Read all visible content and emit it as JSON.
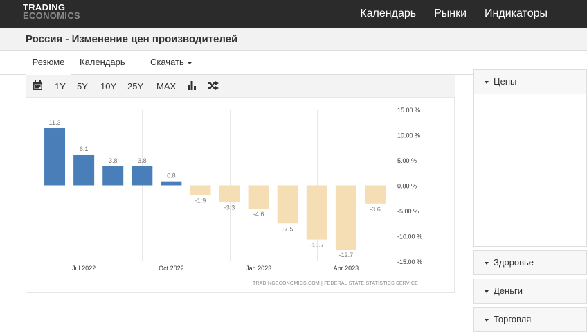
{
  "brand": {
    "line1": "TRADING",
    "line2": "ECONOMICS"
  },
  "nav": [
    {
      "label": "Календарь"
    },
    {
      "label": "Рынки"
    },
    {
      "label": "Индикаторы"
    }
  ],
  "page_title": "Россия - Изменение цен производителей",
  "tabs": [
    {
      "label": "Резюме"
    },
    {
      "label": "Календарь"
    },
    {
      "label": "Скачать"
    }
  ],
  "toolbar": {
    "ranges": [
      "1Y",
      "5Y",
      "10Y",
      "25Y",
      "MAX"
    ],
    "icons": [
      "calendar-icon",
      "bar-chart-icon",
      "shuffle-icon"
    ]
  },
  "sidebar": [
    {
      "label": "Цены"
    },
    {
      "label": "Здоровье"
    },
    {
      "label": "Деньги"
    },
    {
      "label": "Торговля"
    }
  ],
  "colors": {
    "positive": "#4a7eb8",
    "negative": "#f5deb3",
    "topbar": "#2b2b2b"
  },
  "chart_data": {
    "type": "bar",
    "values": [
      11.3,
      6.1,
      3.8,
      3.8,
      0.8,
      -1.9,
      -3.3,
      -4.6,
      -7.5,
      -10.7,
      -12.7,
      -3.6
    ],
    "value_labels": [
      "11.3",
      "6.1",
      "3.8",
      "3.8",
      "0.8",
      "-1.9",
      "-3.3",
      "-4.6",
      "-7.5",
      "-10.7",
      "-12.7",
      "-3.6"
    ],
    "x_tick_labels": [
      "Jul 2022",
      "Oct 2022",
      "Jan 2023",
      "Apr 2023"
    ],
    "y_ticks": [
      15,
      10,
      5,
      0,
      -5,
      -10,
      -15
    ],
    "y_tick_labels": [
      "15.00 %",
      "10.00 %",
      "5.00 %",
      "0.00 %",
      "-5.00 %",
      "-10.00 %",
      "-15.00 %"
    ],
    "ylim": [
      -15,
      15
    ],
    "grid": "vertical",
    "source": "TRADINGECONOMICS.COM  |  FEDERAL STATE STATISTICS SERVICE"
  }
}
